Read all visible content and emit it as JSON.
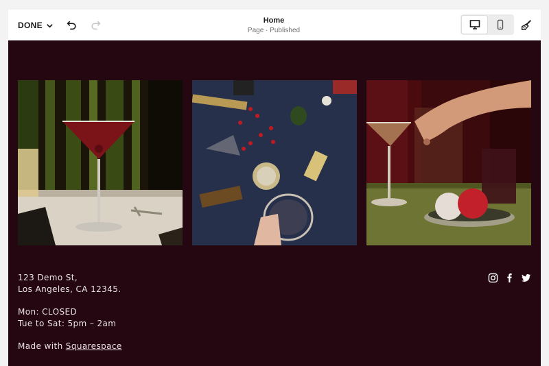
{
  "toolbar": {
    "done_label": "DONE",
    "page_title": "Home",
    "page_status": "Page · Published"
  },
  "gallery": {
    "images": [
      {
        "icon": "martini-cocktail-image"
      },
      {
        "icon": "bar-tools-flatlay-image"
      },
      {
        "icon": "coupe-glass-dessert-image"
      }
    ]
  },
  "footer": {
    "address_line1": "123 Demo St,",
    "address_line2": "Los Angeles, CA 12345.",
    "hours_line1": "Mon: CLOSED",
    "hours_line2": "Tue to Sat: 5pm – 2am",
    "made_with_prefix": "Made with ",
    "made_with_link": "Squarespace"
  },
  "colors": {
    "site_background": "#240711",
    "toolbar_background": "#ffffff",
    "footer_text": "#eae2e4"
  }
}
